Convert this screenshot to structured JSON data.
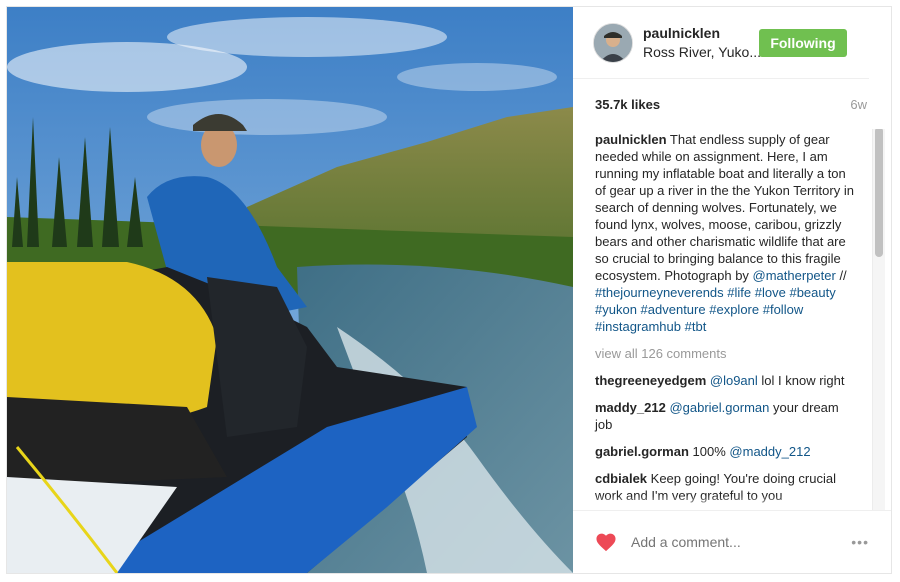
{
  "post": {
    "username": "paulnicklen",
    "location": "Ross River, Yuko...",
    "follow_label": "Following",
    "likes": "35.7k likes",
    "age": "6w",
    "caption_user": "paulnicklen",
    "caption_text": "That endless supply of gear needed while on assignment. Here, I am running my inflatable boat and literally a ton of gear up a river in the the Yukon Territory in search of denning wolves. Fortunately, we found lynx, wolves, moose, caribou, grizzly bears and other charismatic wildlife that are so crucial to bringing balance to this fragile ecosystem. Photograph by ",
    "caption_mention": "@matherpeter",
    "caption_sep": " // ",
    "hashtags": [
      "#thejourneyneverends",
      "#life",
      "#love",
      "#beauty",
      "#yukon",
      "#adventure",
      "#explore",
      "#follow",
      "#instagramhub",
      "#tbt"
    ],
    "view_all": "view all 126 comments",
    "comments": [
      {
        "user": "thegreeneyedgem",
        "mention": "@lo9anl",
        "text": " lol I know right"
      },
      {
        "user": "maddy_212",
        "mention": "@gabriel.gorman",
        "text": " your dream job"
      },
      {
        "user": "gabriel.gorman",
        "pre": "100% ",
        "mention": "@maddy_212",
        "text": ""
      },
      {
        "user": "cdbialek",
        "text": "Keep going! You're doing crucial work and I'm very grateful to you"
      }
    ],
    "add_comment_placeholder": "Add a comment...",
    "more_label": "•••"
  },
  "colors": {
    "follow_button": "#70c050",
    "link": "#125688",
    "heart": "#ed4956"
  },
  "icons": [
    "heart-icon",
    "more-options-icon"
  ]
}
